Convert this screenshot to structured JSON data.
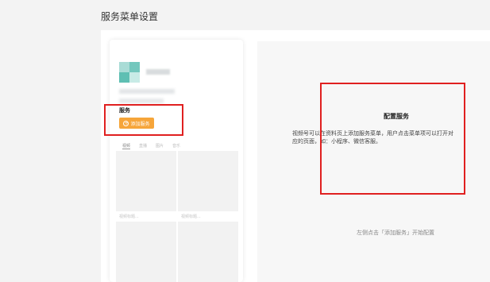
{
  "page": {
    "title": "服务菜单设置"
  },
  "preview": {
    "section_title": "服务",
    "add_button_label": "添加服务",
    "tabs": [
      "视频",
      "直播",
      "图片",
      "音乐"
    ],
    "grid_labels": [
      "视频标题...",
      "视频标题..."
    ]
  },
  "config": {
    "title": "配置服务",
    "description_line1": "视频号可以在资料页上添加服务菜单，用户点击菜单项可以打开对",
    "description_line2": "应的页面，如：小程序、微信客服。",
    "hint": "左侧点击「添加服务」开始配置"
  },
  "colors": {
    "accent": "#f6a53a",
    "highlight": "#e02020"
  },
  "icons": {
    "add": "plus-circle-icon"
  }
}
